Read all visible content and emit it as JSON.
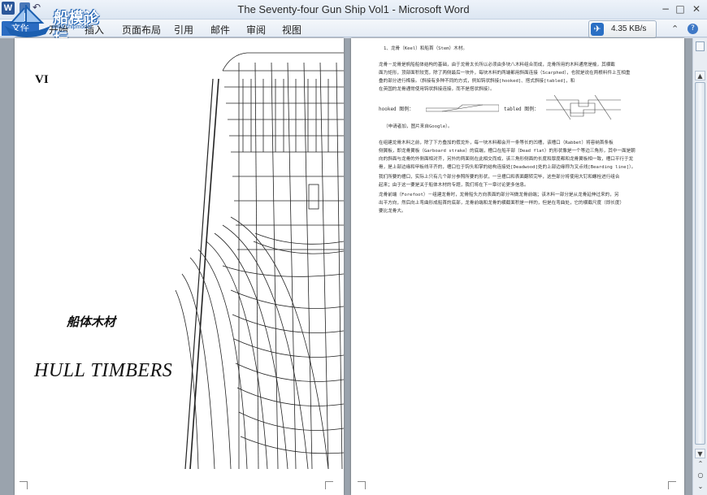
{
  "window": {
    "title": "The Seventy-four Gun Ship Vol1  -  Microsoft Word",
    "app_icon_letter": "W",
    "controls": {
      "minimize": "−",
      "maximize": "□",
      "close": "✕"
    }
  },
  "watermark": {
    "text": "船模论坛",
    "sub": "www.shipmodel"
  },
  "ribbon": {
    "tabs": [
      "文件",
      "开始",
      "插入",
      "页面布局",
      "引用",
      "邮件",
      "审阅",
      "视图"
    ],
    "minimize_ribbon": "⌃",
    "help": "?"
  },
  "network_widget": {
    "value": "4.35 KB/s",
    "icon": "bird-icon"
  },
  "left_page": {
    "chapter_number": "VI",
    "chinese_title": "船体木材",
    "english_title": "HULL TIMBERS"
  },
  "right_page": {
    "heading": "1、龙骨（Keel）和船首（Stem）木材。",
    "para1": [
      "龙骨－龙骨是帆船船体结构的基础，由于龙骨太长所以必须由多块八木料组合而成，龙骨所用的木料通常是榆，其横截",
      "面为矩形，顶部面积较宽，除了两侧最后一块外，每块木料的两端都用斜面连接（Scarphed），也就是说在两根料件上互相重",
      "叠的部分进行榫接。（斜接有多种不同的方式，例如钩状斜接[hooked]、搭式斜接[tabled]，和",
      "在英国的龙骨通常使用钩状斜接连接，而不是搭状斜接）。"
    ],
    "para1_red": [
      "Scarphed",
      "hooked]",
      "tabled]"
    ],
    "hooked_label": "hooked 图例：",
    "tabled_label": "tabled 图例：",
    "source_note": "（申请者加，图片来自Google）。",
    "para2": [
      "在组建龙骨木料之前，除了下方叠加的假龙外，每一块木料都会开一条等长的凹槽，该槽口（Rabbet）将容纳首条板",
      "侧翼板，即龙骨翼板（Garboard strake）的底端，槽口在船平部（Dead flat）的形状像是一个等边三角形，其中一面是朝",
      "向的斜面与龙骨的外侧面相对齐，另外的两面则在此相交而成，该三角形侧面的长度和厚度都和龙骨翼板相一致，槽口平行于龙",
      "骨，是上部边缘和甲板线平齐的，槽口位于钩头和掌的结构连接处[Deadwood]处的上部边缘称为叉点线[Bearding line]）。"
    ],
    "para3": [
      "我们所要的槽口，实际上只有几个部分参照所要的形状，一旦槽口和表面翻转完毕，这些部分将使用大钉和螺栓进行组合",
      "起来；由于这一要是关于船体木材的专题，我们将在下一章讨论更多信息。"
    ],
    "para4": [
      "龙骨前端（Forefoot）－组建龙骨时，龙骨船头方向表面的部分叫做龙骨前端；该木料一部分是从龙骨延伸过来的，另",
      "出平方向，然后向上弯曲形成船首的底部，龙骨前端和龙骨的横截面积是一样的，但是在弯曲处，它的横截尺度（即长度）",
      "要比龙骨大。"
    ]
  },
  "scrollbar": {
    "up": "▲",
    "down": "▼",
    "prev_page": "⌃",
    "browse": "○",
    "next_page": "⌄"
  }
}
